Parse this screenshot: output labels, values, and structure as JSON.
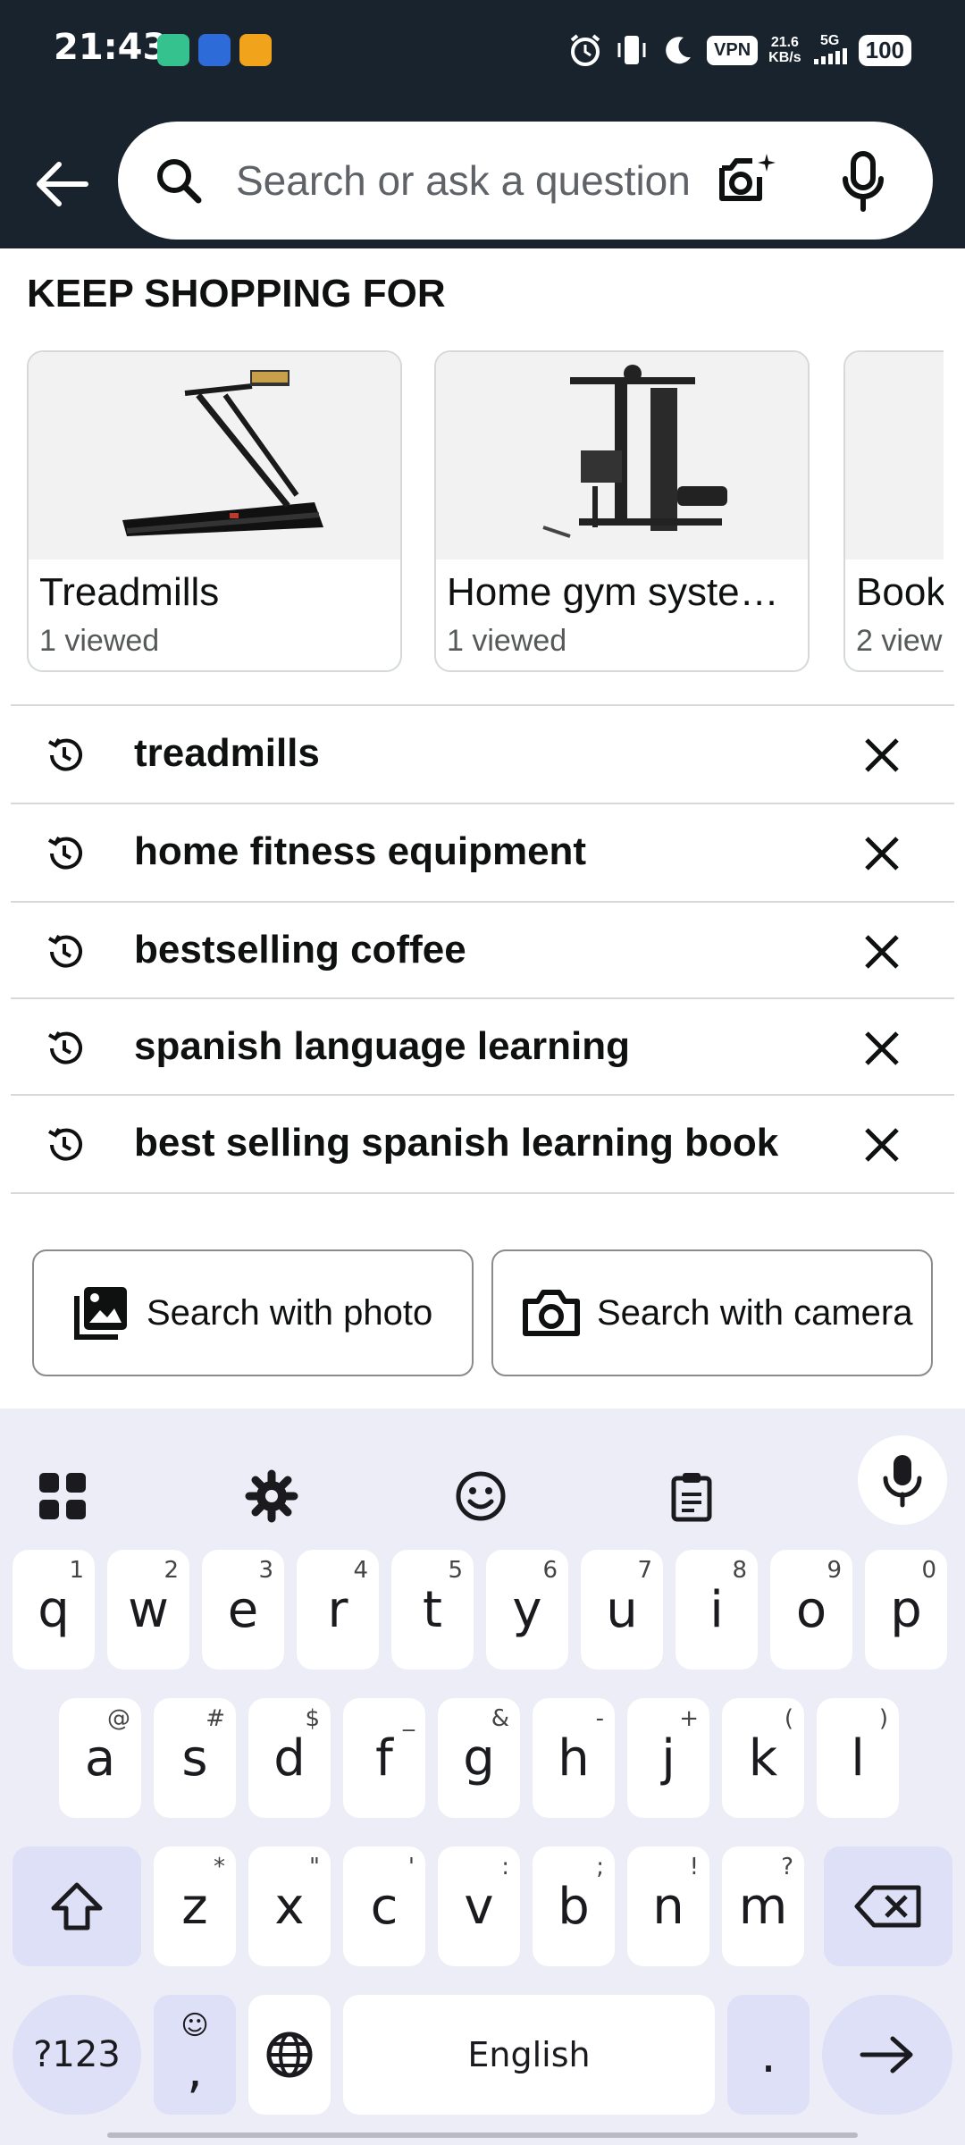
{
  "status_bar": {
    "time": "21:43",
    "vpn": "VPN",
    "speed_value": "21.6",
    "speed_unit": "KB/s",
    "network": "5G",
    "battery": "100"
  },
  "search": {
    "placeholder": "Search or ask a question"
  },
  "keep_shopping": {
    "title": "KEEP SHOPPING FOR",
    "cards": [
      {
        "title": "Treadmills",
        "subtitle": "1 viewed"
      },
      {
        "title": "Home gym syste…",
        "subtitle": "1 viewed"
      },
      {
        "title": "Book",
        "subtitle": "2 view"
      }
    ]
  },
  "history": [
    {
      "label": "treadmills"
    },
    {
      "label": "home fitness equipment"
    },
    {
      "label": "bestselling coffee"
    },
    {
      "label": "spanish language learning"
    },
    {
      "label": "best selling spanish learning book"
    }
  ],
  "search_with": {
    "photo_label": "Search with photo",
    "camera_label": "Search with camera"
  },
  "keyboard": {
    "row1": [
      {
        "k": "q",
        "h": "1"
      },
      {
        "k": "w",
        "h": "2"
      },
      {
        "k": "e",
        "h": "3"
      },
      {
        "k": "r",
        "h": "4"
      },
      {
        "k": "t",
        "h": "5"
      },
      {
        "k": "y",
        "h": "6"
      },
      {
        "k": "u",
        "h": "7"
      },
      {
        "k": "i",
        "h": "8"
      },
      {
        "k": "o",
        "h": "9"
      },
      {
        "k": "p",
        "h": "0"
      }
    ],
    "row2": [
      {
        "k": "a",
        "h": "@"
      },
      {
        "k": "s",
        "h": "#"
      },
      {
        "k": "d",
        "h": "$"
      },
      {
        "k": "f",
        "h": "_"
      },
      {
        "k": "g",
        "h": "&"
      },
      {
        "k": "h",
        "h": "-"
      },
      {
        "k": "j",
        "h": "+"
      },
      {
        "k": "k",
        "h": "("
      },
      {
        "k": "l",
        "h": ")"
      }
    ],
    "row3": [
      {
        "k": "z",
        "h": "*"
      },
      {
        "k": "x",
        "h": "\""
      },
      {
        "k": "c",
        "h": "'"
      },
      {
        "k": "v",
        "h": ":"
      },
      {
        "k": "b",
        "h": ";"
      },
      {
        "k": "n",
        "h": "!"
      },
      {
        "k": "m",
        "h": "?"
      }
    ],
    "symbols_label": "?123",
    "comma_label": ",",
    "space_label": "English",
    "period_label": "."
  },
  "colors": {
    "header_bg": "#19232d",
    "keyboard_bg": "#ecedf6",
    "special_key_bg": "#dde0f6"
  },
  "icons": {
    "back": "arrow-left-icon",
    "search": "magnifier-icon",
    "camera_search": "camera-sparkle-icon",
    "voice": "mic-icon",
    "history": "history-clock-icon",
    "remove": "close-x-icon",
    "photo": "image-stack-icon",
    "camera": "camera-icon"
  }
}
